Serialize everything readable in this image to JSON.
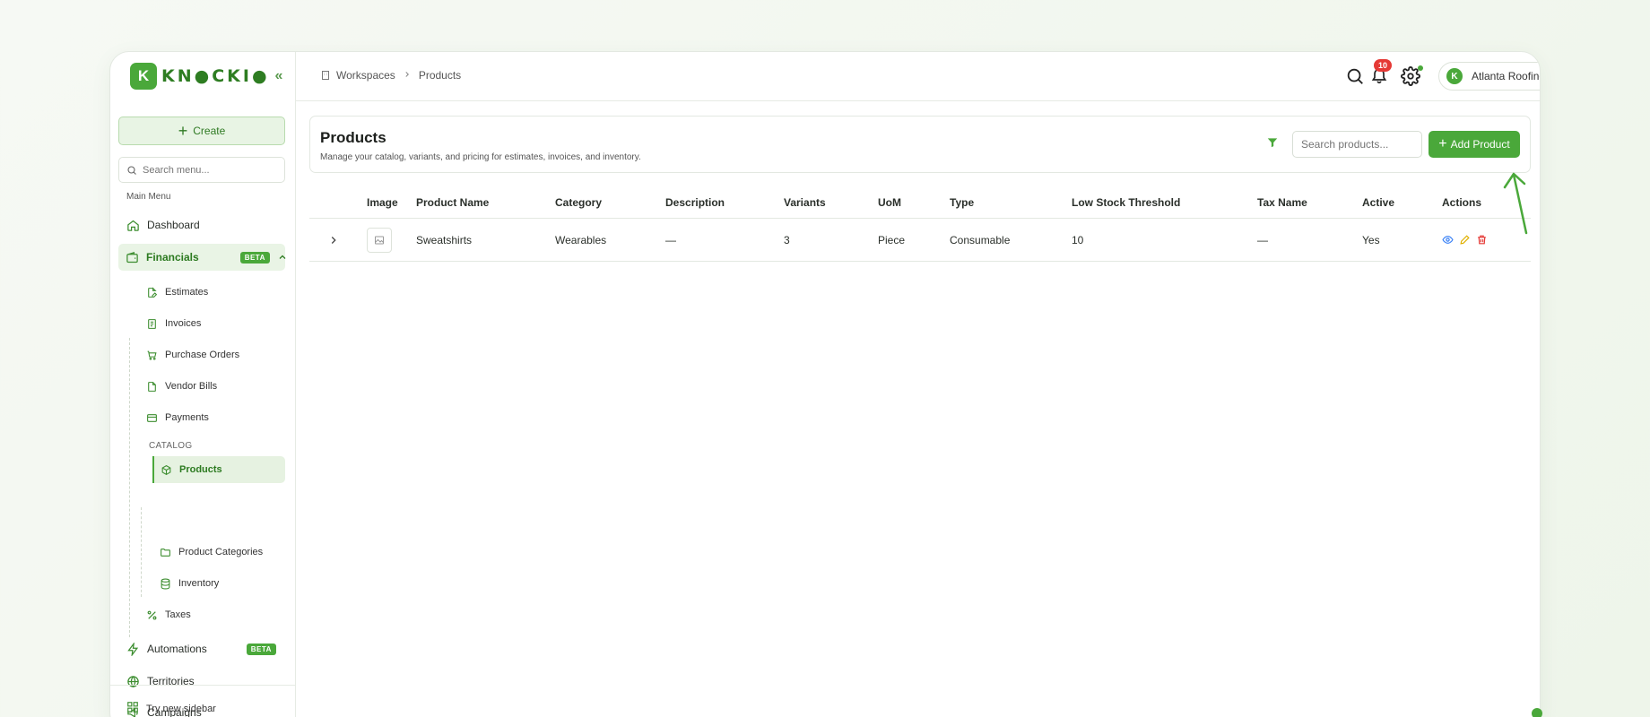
{
  "app": {
    "logo_letter": "K",
    "logo_text": "KN●CKI●",
    "colors": {
      "accent": "#4aa83a",
      "accent_dark": "#2e7d22",
      "danger": "#e53935",
      "view": "#3b82f6",
      "edit": "#e0b000"
    }
  },
  "sidebar": {
    "create_label": "Create",
    "search_placeholder": "Search menu...",
    "section_label": "Main Menu",
    "items": {
      "dashboard": "Dashboard",
      "financials": "Financials",
      "financials_badge": "BETA",
      "automations": "Automations",
      "automations_badge": "BETA",
      "territories": "Territories",
      "campaigns": "Campaigns"
    },
    "financial_subitems": {
      "estimates": "Estimates",
      "invoices": "Invoices",
      "purchase_orders": "Purchase Orders",
      "vendor_bills": "Vendor Bills",
      "payments": "Payments",
      "catalog_label": "CATALOG",
      "products": "Products",
      "product_categories": "Product Categories",
      "inventory": "Inventory",
      "taxes": "Taxes"
    },
    "footer_label": "Try new sidebar"
  },
  "header": {
    "breadcrumb": [
      "Workspaces",
      "Products"
    ],
    "notification_count": "10",
    "workspace_name": "Atlanta Roofing",
    "avatar_letter": "K"
  },
  "page": {
    "title": "Products",
    "subtitle": "Manage your catalog, variants, and pricing for estimates, invoices, and inventory.",
    "search_placeholder": "Search products...",
    "add_label": "Add Product"
  },
  "table": {
    "columns": [
      "Image",
      "Product Name",
      "Category",
      "Description",
      "Variants",
      "UoM",
      "Type",
      "Low Stock Threshold",
      "Tax Name",
      "Active",
      "Actions"
    ],
    "rows": [
      {
        "name": "Sweatshirts",
        "category": "Wearables",
        "description": "—",
        "variants": "3",
        "uom": "Piece",
        "type": "Consumable",
        "low_stock": "10",
        "tax_name": "—",
        "active": "Yes"
      }
    ]
  }
}
